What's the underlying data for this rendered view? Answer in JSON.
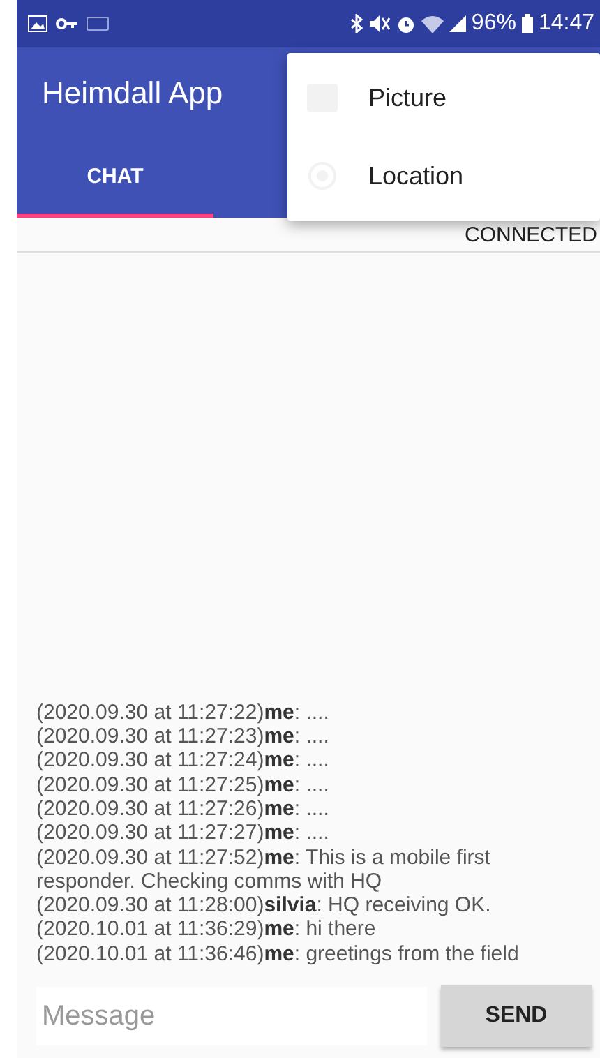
{
  "status_bar": {
    "battery": "96%",
    "time": "14:47"
  },
  "app_bar": {
    "title": "Heimdall App"
  },
  "tabs": [
    {
      "label": "CHAT",
      "selected": true
    }
  ],
  "menu": {
    "items": [
      {
        "label": "Picture",
        "kind": "picture"
      },
      {
        "label": "Location",
        "kind": "location"
      }
    ]
  },
  "connection_status": "CONNECTED",
  "messages": [
    "(2020.09.30 at 11:27:22)**me**: ....",
    "(2020.09.30 at 11:27:23)**me**: ....",
    "(2020.09.30 at 11:27:24)**me**: ....",
    "(2020.09.30 at 11:27:25)**me**: ....",
    "(2020.09.30 at 11:27:26)**me**: ....",
    "(2020.09.30 at 11:27:27)**me**: ....",
    "(2020.09.30 at 11:27:52)**me**: This is a mobile first responder. Checking comms with HQ",
    "(2020.09.30 at 11:28:00)**silvia**: HQ receiving OK.",
    "(2020.10.01 at 11:36:29)**me**: hi there",
    "(2020.10.01 at 11:36:46)**me**: greetings from the field"
  ],
  "composer": {
    "placeholder": "Message",
    "send": "SEND"
  }
}
